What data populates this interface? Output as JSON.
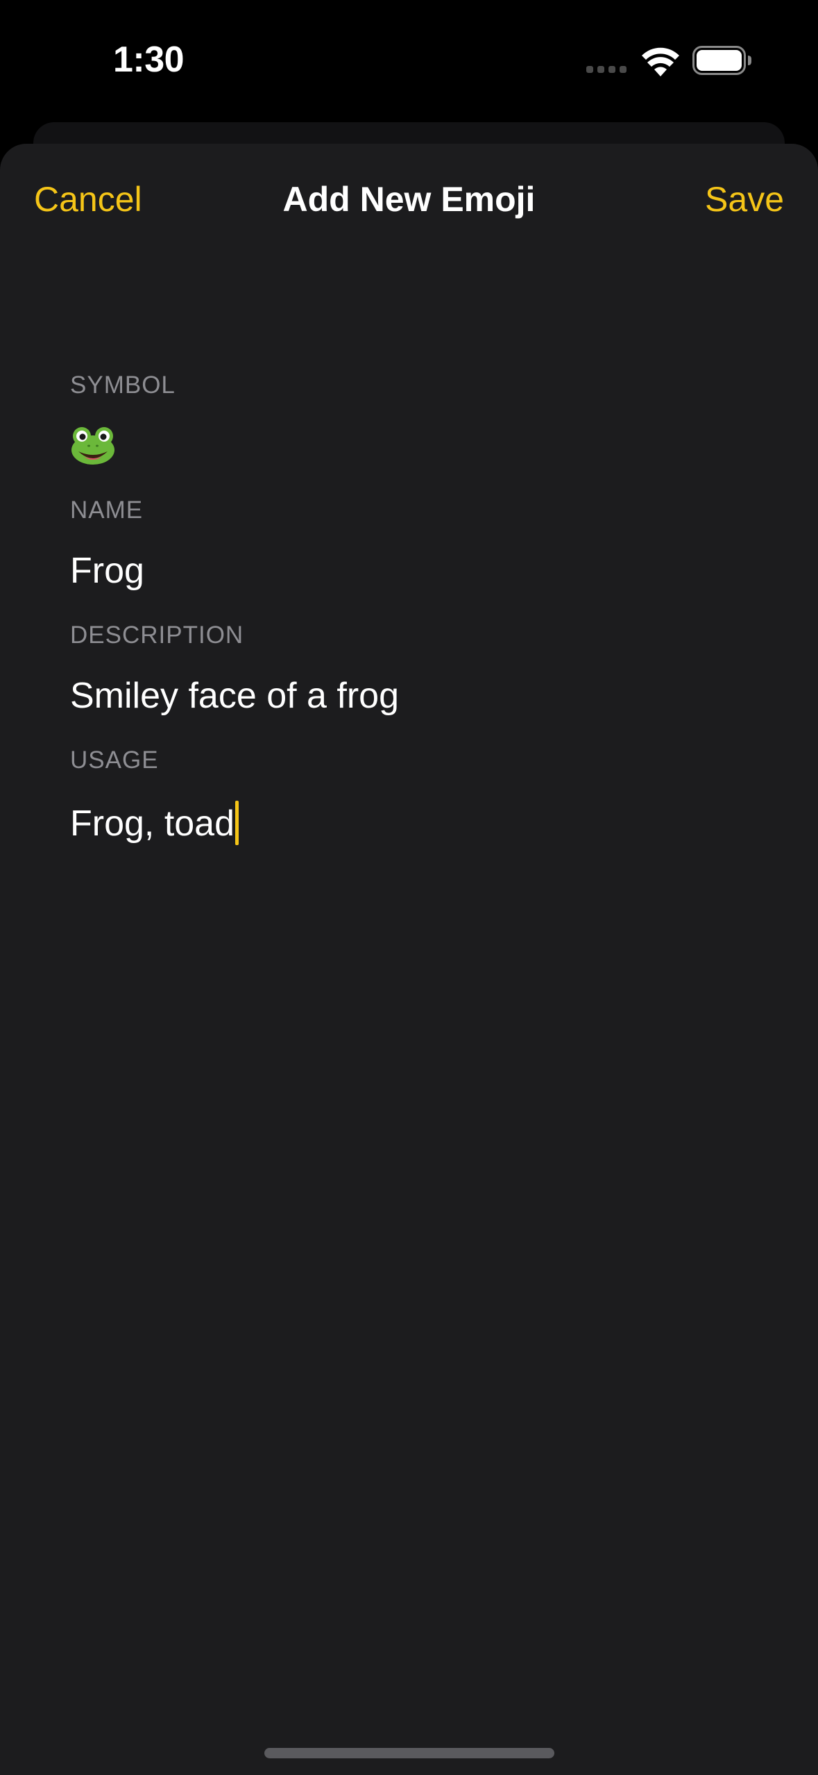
{
  "status_bar": {
    "time": "1:30",
    "icons": [
      "cellular-signal-icon",
      "wifi-icon",
      "battery-icon"
    ]
  },
  "nav": {
    "cancel_label": "Cancel",
    "title": "Add New Emoji",
    "save_label": "Save"
  },
  "form": {
    "symbol": {
      "header": "SYMBOL",
      "value": "🐸"
    },
    "name": {
      "header": "NAME",
      "value": "Frog"
    },
    "description": {
      "header": "DESCRIPTION",
      "value": "Smiley face of a frog"
    },
    "usage": {
      "header": "USAGE",
      "value": "Frog, toad"
    }
  },
  "colors": {
    "accent": "#f5c518",
    "sheet_background": "#1c1c1e",
    "section_header": "#8e8e93",
    "text": "#ffffff"
  }
}
